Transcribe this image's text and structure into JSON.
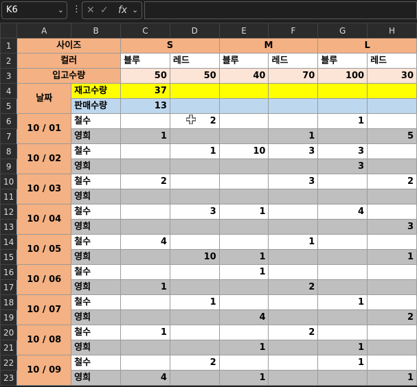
{
  "namebox": {
    "value": "K6"
  },
  "fx": {
    "label": "fx"
  },
  "columns": [
    "A",
    "B",
    "C",
    "D",
    "E",
    "F",
    "G",
    "H"
  ],
  "rows": [
    "1",
    "2",
    "3",
    "4",
    "5",
    "6",
    "7",
    "8",
    "9",
    "10",
    "11",
    "12",
    "13",
    "14",
    "15",
    "16",
    "17",
    "18",
    "19",
    "20",
    "21",
    "22",
    "23"
  ],
  "header": {
    "size_label": "사이즈",
    "color_label": "컬러",
    "stock_in_label": "입고수량",
    "sizes": [
      "S",
      "M",
      "L"
    ],
    "colors": [
      "블루",
      "레드",
      "블루",
      "레드",
      "블루",
      "레드"
    ],
    "stock_in": [
      "50",
      "50",
      "40",
      "70",
      "100",
      "30"
    ],
    "date_label": "날짜",
    "inventory_label": "재고수량",
    "inventory_value": "37",
    "sales_label": "판매수량",
    "sales_value": "13"
  },
  "records": [
    {
      "date": "10 / 01",
      "a": {
        "name": "철수",
        "v": [
          "",
          "2",
          "",
          "",
          "1",
          ""
        ]
      },
      "b": {
        "name": "영희",
        "v": [
          "1",
          "",
          "",
          "1",
          "",
          "5"
        ]
      }
    },
    {
      "date": "10 / 02",
      "a": {
        "name": "철수",
        "v": [
          "",
          "1",
          "10",
          "3",
          "3",
          ""
        ]
      },
      "b": {
        "name": "영희",
        "v": [
          "",
          "",
          "",
          "",
          "3",
          ""
        ]
      }
    },
    {
      "date": "10 / 03",
      "a": {
        "name": "철수",
        "v": [
          "2",
          "",
          "",
          "3",
          "",
          "2"
        ]
      },
      "b": {
        "name": "영희",
        "v": [
          "",
          "",
          "",
          "",
          "",
          ""
        ]
      }
    },
    {
      "date": "10 / 04",
      "a": {
        "name": "철수",
        "v": [
          "",
          "3",
          "1",
          "",
          "4",
          ""
        ]
      },
      "b": {
        "name": "영희",
        "v": [
          "",
          "",
          "",
          "",
          "",
          "3"
        ]
      }
    },
    {
      "date": "10 / 05",
      "a": {
        "name": "철수",
        "v": [
          "4",
          "",
          "",
          "1",
          "",
          ""
        ]
      },
      "b": {
        "name": "영희",
        "v": [
          "",
          "10",
          "1",
          "",
          "",
          "1"
        ]
      }
    },
    {
      "date": "10 / 06",
      "a": {
        "name": "철수",
        "v": [
          "",
          "",
          "1",
          "",
          "",
          ""
        ]
      },
      "b": {
        "name": "영희",
        "v": [
          "1",
          "",
          "",
          "2",
          "",
          ""
        ]
      }
    },
    {
      "date": "10 / 07",
      "a": {
        "name": "철수",
        "v": [
          "",
          "1",
          "",
          "",
          "1",
          ""
        ]
      },
      "b": {
        "name": "영희",
        "v": [
          "",
          "",
          "4",
          "",
          "",
          "2"
        ]
      }
    },
    {
      "date": "10 / 08",
      "a": {
        "name": "철수",
        "v": [
          "1",
          "",
          "",
          "2",
          "",
          ""
        ]
      },
      "b": {
        "name": "영희",
        "v": [
          "",
          "",
          "1",
          "",
          "1",
          ""
        ]
      }
    },
    {
      "date": "10 / 09",
      "a": {
        "name": "철수",
        "v": [
          "",
          "2",
          "",
          "",
          "1",
          ""
        ]
      },
      "b": {
        "name": "영희",
        "v": [
          "4",
          "",
          "1",
          "",
          "",
          "1"
        ]
      }
    }
  ]
}
